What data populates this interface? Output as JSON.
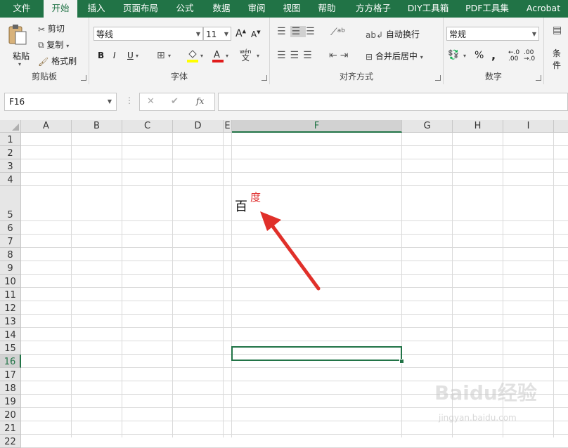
{
  "ribbon": {
    "tabs": [
      "文件",
      "开始",
      "插入",
      "页面布局",
      "公式",
      "数据",
      "审阅",
      "视图",
      "帮助",
      "方方格子",
      "DIY工具箱",
      "PDF工具集",
      "Acrobat"
    ],
    "active_tab": "开始",
    "clipboard": {
      "paste": "粘贴",
      "cut": "剪切",
      "copy": "复制",
      "format_painter": "格式刷",
      "label": "剪贴板"
    },
    "font": {
      "name": "等线",
      "size": "11",
      "bold": "B",
      "italic": "I",
      "underline": "U",
      "phonetic": "wén",
      "label": "字体"
    },
    "alignment": {
      "wrap_text": "自动换行",
      "merge_center": "合并后居中",
      "label": "对齐方式"
    },
    "number": {
      "format": "常规",
      "percent": "%",
      "comma": ",",
      "label": "数字"
    },
    "styles": {
      "conditional": "条件"
    }
  },
  "formula_bar": {
    "name_box": "F16",
    "cancel": "✕",
    "enter": "✔",
    "fx": "fx",
    "formula": ""
  },
  "grid": {
    "columns": [
      "A",
      "B",
      "C",
      "D",
      "E",
      "F",
      "G",
      "H",
      "I"
    ],
    "selected_column": "F",
    "rows": [
      "1",
      "2",
      "3",
      "4",
      "5",
      "6",
      "7",
      "8",
      "9",
      "10",
      "11",
      "12",
      "13",
      "14",
      "15",
      "16",
      "17",
      "18",
      "19",
      "20",
      "21",
      "22"
    ],
    "selected_row": "16",
    "cell_F5_text": "百",
    "cell_F5_phonetic": "度"
  },
  "watermark": {
    "logo": "Baidu经验",
    "url": "jingyan.baidu.com"
  },
  "colors": {
    "accent": "#217346",
    "arrow": "#e0302a",
    "phonetic": "#e03030"
  }
}
